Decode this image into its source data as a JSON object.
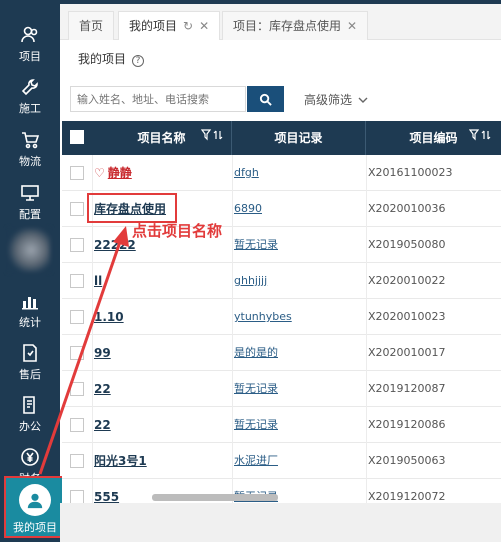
{
  "sidebar": {
    "items": [
      {
        "label": "项目",
        "icon": "people-icon"
      },
      {
        "label": "施工",
        "icon": "wrench-icon"
      },
      {
        "label": "物流",
        "icon": "cart-icon"
      },
      {
        "label": "配置",
        "icon": "monitor-icon"
      },
      {
        "label": "统计",
        "icon": "chart-icon"
      },
      {
        "label": "售后",
        "icon": "shield-doc-icon"
      },
      {
        "label": "办公",
        "icon": "doc-edit-icon"
      },
      {
        "label": "财务",
        "icon": "yen-icon"
      }
    ],
    "my_project": "我的项目"
  },
  "tabs": [
    {
      "label": "首页"
    },
    {
      "label": "我的项目"
    },
    {
      "label": "项目：库存盘点使用"
    }
  ],
  "page": {
    "title": "我的项目",
    "help": "?"
  },
  "search": {
    "placeholder": "输入姓名、地址、电话搜索",
    "advanced": "高级筛选"
  },
  "table": {
    "headers": [
      "项目名称",
      "项目记录",
      "项目编码"
    ],
    "rows": [
      {
        "name": "静静",
        "record": "dfgh",
        "code": "X20161100023"
      },
      {
        "name": "库存盘点使用",
        "record": "6890",
        "code": "X2020010036"
      },
      {
        "name": "22222",
        "record": "暂无记录",
        "code": "X2019050080"
      },
      {
        "name": "ll",
        "record": "ghhjjjj",
        "code": "X2020010022"
      },
      {
        "name": "1.10",
        "record": "ytunhybes",
        "code": "X2020010023"
      },
      {
        "name": "99",
        "record": "是的是的",
        "code": "X2020010017"
      },
      {
        "name": "22",
        "record": "暂无记录",
        "code": "X2019120087"
      },
      {
        "name": "22",
        "record": "暂无记录",
        "code": "X2019120086"
      },
      {
        "name": "阳光3号1",
        "record": "水泥进厂",
        "code": "X2019050063"
      },
      {
        "name": "555",
        "record": "暂无记录",
        "code": "X2019120072"
      }
    ]
  },
  "annotation": {
    "text": "点击项目名称",
    "color": "#e23b3b"
  },
  "colors": {
    "sidebar": "#1e3a52",
    "accent": "#1a8ba0",
    "highlight": "#e23b3b"
  }
}
